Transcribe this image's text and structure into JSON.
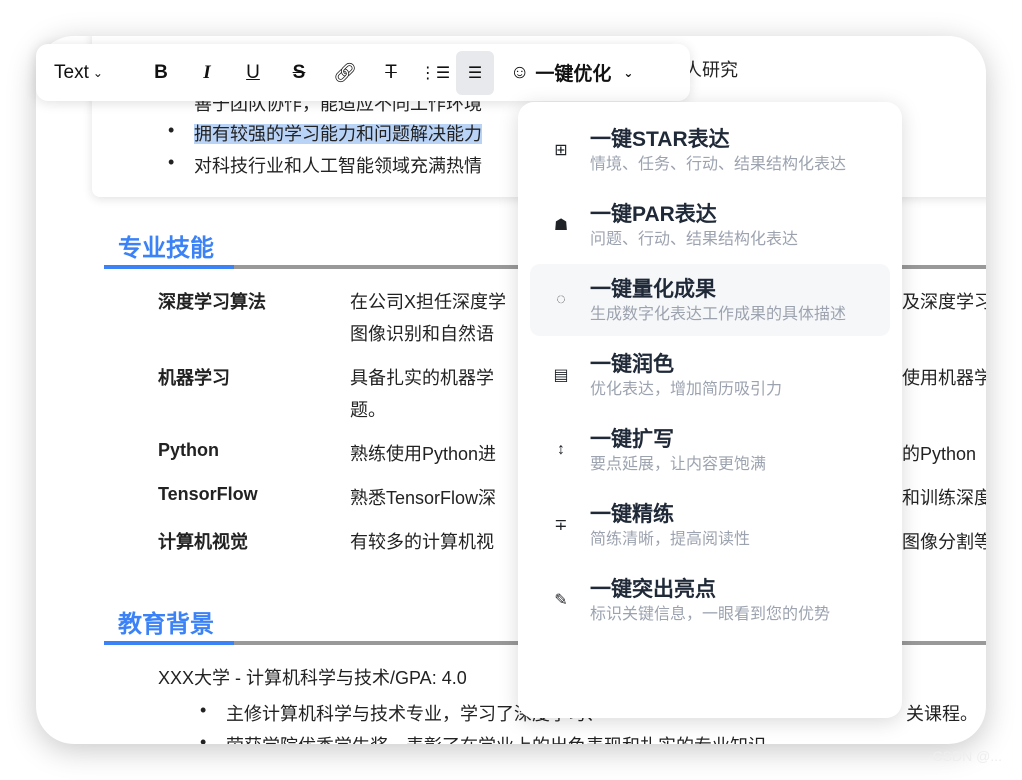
{
  "doc": {
    "top_fragment": "人研究",
    "bullets": [
      "善于团队协作，能适应不同工作环境",
      "拥有较强的学习能力和问题解决能力",
      "对科技行业和人工智能领域充满热情"
    ],
    "skills_title": "专业技能",
    "skills": [
      {
        "name": "深度学习算法",
        "left": [
          "在公司X担任深度学",
          "图像识别和自然语"
        ],
        "right": [
          "及深度学习"
        ]
      },
      {
        "name": "机器学习",
        "left": [
          "具备扎实的机器学",
          "题。"
        ],
        "right": [
          "使用机器学"
        ]
      },
      {
        "name": "Python",
        "left": [
          "熟练使用Python进"
        ],
        "right": [
          "的Python"
        ]
      },
      {
        "name": "TensorFlow",
        "left": [
          "熟悉TensorFlow深"
        ],
        "right": [
          "和训练深度"
        ]
      },
      {
        "name": "计算机视觉",
        "left": [
          "有较多的计算机视"
        ],
        "right": [
          "图像分割等"
        ]
      }
    ],
    "edu_title": "教育背景",
    "edu_line": "XXX大学 - 计算机科学与技术/GPA: 4.0",
    "edu_bullets": [
      {
        "left": "主修计算机科学与技术专业，学习了深度学习、",
        "right": "关课程。"
      },
      {
        "left": "荣获学院优秀学生奖，表彰了在学业上的出色表现和扎实的专业知识",
        "right": ""
      }
    ]
  },
  "toolbar": {
    "text_style": "Text",
    "optimize_label": "一键优化",
    "active": "bullet-list"
  },
  "menu": {
    "items": [
      {
        "icon": "grid-icon",
        "title": "一键STAR表达",
        "desc": "情境、任务、行动、结果结构化表达"
      },
      {
        "icon": "hierarchy-icon",
        "title": "一键PAR表达",
        "desc": "问题、行动、结果结构化表达"
      },
      {
        "icon": "quantify-icon",
        "title": "一键量化成果",
        "desc": "生成数字化表达工作成果的具体描述",
        "highlighted": true
      },
      {
        "icon": "typewriter-icon",
        "title": "一键润色",
        "desc": "优化表达，增加简历吸引力"
      },
      {
        "icon": "expand-icon",
        "title": "一键扩写",
        "desc": "要点延展，让内容更饱满"
      },
      {
        "icon": "compress-icon",
        "title": "一键精练",
        "desc": "简练清晰，提高阅读性"
      },
      {
        "icon": "highlighter-icon",
        "title": "一键突出亮点",
        "desc": "标识关键信息，一眼看到您的优势"
      }
    ]
  },
  "watermark": "CSDN @..."
}
